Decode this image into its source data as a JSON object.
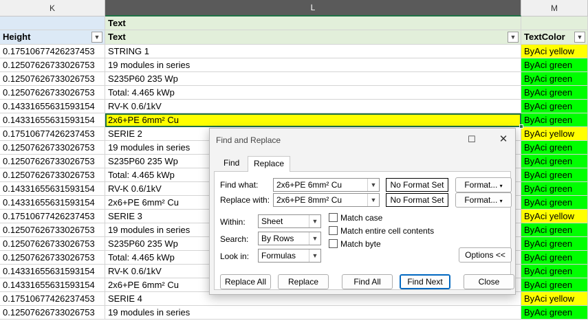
{
  "columns": {
    "k": "K",
    "l": "L",
    "m": "M"
  },
  "header": {
    "row1_l": "Text",
    "k": "Height",
    "l": "Text",
    "m": "TextColor"
  },
  "rows": [
    {
      "height": "0.17510677426237453",
      "text": "STRING 1",
      "color": "ByAci yellow"
    },
    {
      "height": "0.12507626733026753",
      "text": "19 modules in series",
      "color": "ByAci green"
    },
    {
      "height": "0.12507626733026753",
      "text": "S235P60 235 Wp",
      "color": "ByAci green"
    },
    {
      "height": "0.12507626733026753",
      "text": "Total: 4.465 kWp",
      "color": "ByAci green"
    },
    {
      "height": "0.14331655631593154",
      "text": "RV-K 0.6/1kV",
      "color": "ByAci green"
    },
    {
      "height": "0.14331655631593154",
      "text": "2x6+PE 6mm² Cu",
      "color": "ByAci green"
    },
    {
      "height": "0.17510677426237453",
      "text": "SERIE 2",
      "color": "ByAci yellow"
    },
    {
      "height": "0.12507626733026753",
      "text": "19 modules in series",
      "color": "ByAci green"
    },
    {
      "height": "0.12507626733026753",
      "text": "S235P60 235 Wp",
      "color": "ByAci green"
    },
    {
      "height": "0.12507626733026753",
      "text": "Total: 4.465 kWp",
      "color": "ByAci green"
    },
    {
      "height": "0.14331655631593154",
      "text": "RV-K 0.6/1kV",
      "color": "ByAci green"
    },
    {
      "height": "0.14331655631593154",
      "text": "2x6+PE 6mm² Cu",
      "color": "ByAci green"
    },
    {
      "height": "0.17510677426237453",
      "text": "SERIE 3",
      "color": "ByAci yellow"
    },
    {
      "height": "0.12507626733026753",
      "text": "19 modules in series",
      "color": "ByAci green"
    },
    {
      "height": "0.12507626733026753",
      "text": "S235P60 235 Wp",
      "color": "ByAci green"
    },
    {
      "height": "0.12507626733026753",
      "text": "Total: 4.465 kWp",
      "color": "ByAci green"
    },
    {
      "height": "0.14331655631593154",
      "text": "RV-K 0.6/1kV",
      "color": "ByAci green"
    },
    {
      "height": "0.14331655631593154",
      "text": "2x6+PE 6mm² Cu",
      "color": "ByAci green"
    },
    {
      "height": "0.17510677426237453",
      "text": "SERIE 4",
      "color": "ByAci yellow"
    },
    {
      "height": "0.12507626733026753",
      "text": "19 modules in series",
      "color": "ByAci green"
    }
  ],
  "selected_row": 5,
  "colors": {
    "yellow": "#ffff00",
    "green": "#00ff00",
    "selection": "#1e7145"
  },
  "dialog": {
    "title": "Find and Replace",
    "tabs": {
      "find": "Find",
      "replace": "Replace"
    },
    "find_what_label": "Find what:",
    "find_what_value": "2x6+PE 6mm² Cu",
    "replace_with_label": "Replace with:",
    "replace_with_value": "2x6+PE 8mm² Cu",
    "no_format_set": "No Format Set",
    "format_button": "Format...",
    "within_label": "Within:",
    "within_value": "Sheet",
    "search_label": "Search:",
    "search_value": "By Rows",
    "look_in_label": "Look in:",
    "look_in_value": "Formulas",
    "match_case": "Match case",
    "match_entire": "Match entire cell contents",
    "match_byte": "Match byte",
    "options_button": "Options <<",
    "replace_all": "Replace All",
    "replace": "Replace",
    "find_all": "Find All",
    "find_next": "Find Next",
    "close": "Close"
  }
}
